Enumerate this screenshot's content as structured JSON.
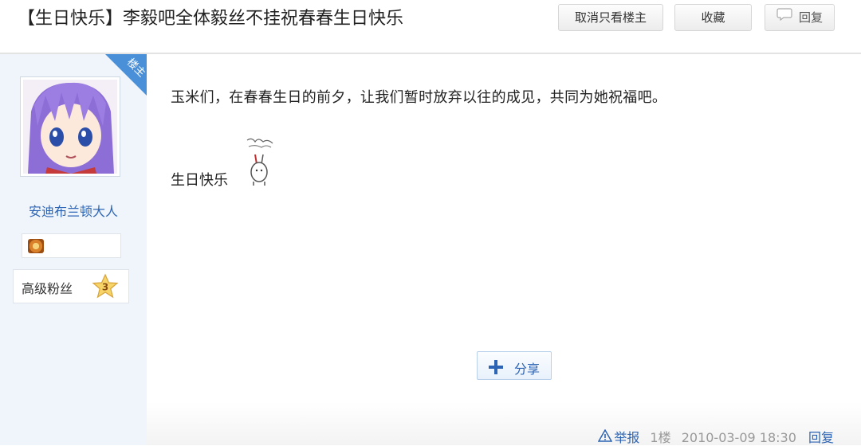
{
  "header": {
    "title": "【生日快乐】李毅吧全体毅丝不挂祝春春生日快乐",
    "only_op_label": "取消只看楼主",
    "collect_label": "收藏",
    "reply_label": "回复"
  },
  "author": {
    "op_tag": "楼主",
    "username": "安迪布兰顿大人",
    "level_name": "高级粉丝",
    "level": "3"
  },
  "post": {
    "body": "玉米们，在春春生日的前夕，让我们暂时放弃以往的成见，共同为她祝福吧。",
    "birthday_line": "生日快乐",
    "share_label": "分享"
  },
  "footer": {
    "report_label": "举报",
    "floor": "1楼",
    "timestamp": "2010-03-09 18:30",
    "reply_label": "回复"
  },
  "colors": {
    "link": "#2d64b3",
    "sidebar_bg": "#f0f5fb",
    "op_tag_bg": "#4a90d9"
  }
}
